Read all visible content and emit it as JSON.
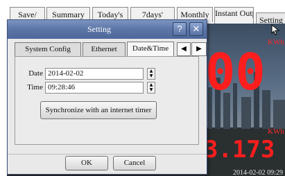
{
  "top_tabs": [
    {
      "label": "Save/"
    },
    {
      "label": "Summary"
    },
    {
      "label": "Today's"
    },
    {
      "label": "7days'"
    },
    {
      "label": "Monthly"
    },
    {
      "label": "Instant Output"
    },
    {
      "label": "Setting"
    }
  ],
  "background": {
    "kwh_label_top": "KWh",
    "kwh_label_bottom": "KWh",
    "big_digits": "00",
    "reading": "3.173",
    "timestamp": "2014-02-02 09:29"
  },
  "dialog": {
    "title": "Setting",
    "help_button": "?",
    "close_button": "✕",
    "tabs": [
      {
        "label": "System Config"
      },
      {
        "label": "Ethernet"
      },
      {
        "label": "Date&Time",
        "selected": true
      }
    ],
    "date_label": "Date",
    "date_value": "2014-02-02",
    "time_label": "Time",
    "time_value": "09:28:46",
    "sync_button": "Synchronize with an internet timer",
    "ok_button": "OK",
    "cancel_button": "Cancel"
  },
  "icons": {
    "prev_tab": "triangle-left-icon",
    "next_tab": "triangle-right-icon",
    "spin_up": "triangle-up-icon",
    "spin_down": "triangle-down-icon",
    "cursor": "mouse-pointer-icon"
  },
  "colors": {
    "titlebar": "#5d77a8",
    "display_red": "#ff1e1e"
  }
}
